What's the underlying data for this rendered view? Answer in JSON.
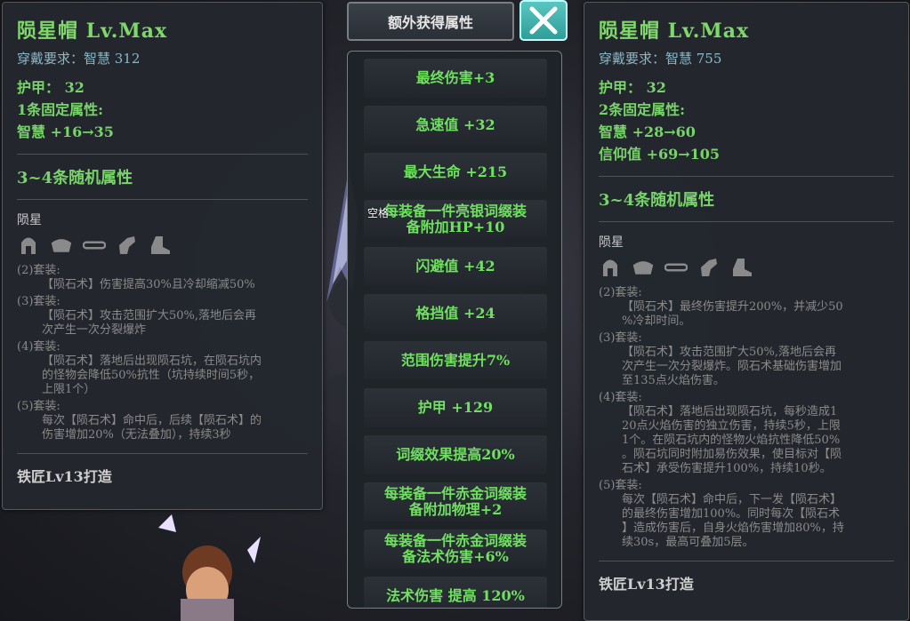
{
  "left_item": {
    "title": "陨星帽 Lv.Max",
    "requirement": "穿戴要求：智慧 312",
    "armor": "护甲：  32",
    "fixed_header": "1条固定属性:",
    "fixed": [
      "智慧 +16→35"
    ],
    "random_header": "3~4条随机属性",
    "set_name": "陨星",
    "set_icons": [
      "helmet-icon",
      "shoulder-armor-icon",
      "belt-icon",
      "glove-icon",
      "boot-icon"
    ],
    "bonuses": [
      {
        "head": "(2)套装:",
        "body": [
          "【陨石术】伤害提高30%且冷却缩减50%"
        ]
      },
      {
        "head": "(3)套装:",
        "body": [
          "【陨石术】攻击范围扩大50%,落地后会再",
          "次产生一次分裂爆炸"
        ]
      },
      {
        "head": "(4)套装:",
        "body": [
          "【陨石术】落地后出现陨石坑，在陨石坑内",
          "的怪物会降低50%抗性（坑持续时间5秒，",
          "上限1个）"
        ]
      },
      {
        "head": "(5)套装:",
        "body": [
          "每次【陨石术】命中后，后续【陨石术】的",
          "伤害增加20%（无法叠加），持续3秒"
        ]
      }
    ],
    "crafter": "铁匠Lv13打造"
  },
  "extra": {
    "tab_label": "额外获得属性",
    "close_icon": "close-icon",
    "space_hint": "空格",
    "attributes": [
      [
        "最终伤害+3"
      ],
      [
        "急速值 +32"
      ],
      [
        "最大生命 +215"
      ],
      [
        "每装备一件亮银词缀装",
        "备附加HP+10"
      ],
      [
        "闪避值 +42"
      ],
      [
        "格挡值 +24"
      ],
      [
        "范围伤害提升7%"
      ],
      [
        "护甲 +129"
      ],
      [
        "词缀效果提高20%"
      ],
      [
        "每装备一件赤金词缀装",
        "备附加物理+2"
      ],
      [
        "每装备一件赤金词缀装",
        "备法术伤害+6%"
      ],
      [
        "法术伤害 提高 120%"
      ]
    ]
  },
  "right_item": {
    "title": "陨星帽 Lv.Max",
    "requirement": "穿戴要求：智慧 755",
    "armor": "护甲：  32",
    "fixed_header": "2条固定属性:",
    "fixed": [
      "智慧 +28→60",
      "信仰值 +69→105"
    ],
    "random_header": "3~4条随机属性",
    "set_name": "陨星",
    "set_icons": [
      "helmet-icon",
      "shoulder-armor-icon",
      "belt-icon",
      "glove-icon",
      "boot-icon"
    ],
    "bonuses": [
      {
        "head": "(2)套装:",
        "body": [
          "【陨石术】最终伤害提升200%，并减少50",
          "%冷却时间。"
        ]
      },
      {
        "head": "(3)套装:",
        "body": [
          "【陨石术】攻击范围扩大50%,落地后会再",
          "次产生一次分裂爆炸。陨石术基础伤害增加",
          "至135点火焰伤害。"
        ]
      },
      {
        "head": "(4)套装:",
        "body": [
          "【陨石术】落地后出现陨石坑，每秒造成1",
          "20点火焰伤害的独立伤害，持续5秒，上限",
          "1个。在陨石坑内的怪物火焰抗性降低50%",
          "。陨石坑同时附加易伤效果，使目标对【陨",
          "石术】承受伤害提升100%，持续10秒。"
        ]
      },
      {
        "head": "(5)套装:",
        "body": [
          "每次【陨石术】命中后，下一发【陨石术】",
          "的最终伤害增加100%。同时每次【陨石术",
          "】造成伤害后，自身火焰伤害增加80%，持",
          "续30s，最高可叠加5层。"
        ]
      }
    ],
    "crafter": "铁匠Lv13打造"
  },
  "colors": {
    "title_green": "#7fd86a",
    "attr_green": "#6fe060",
    "requirement": "#8ab8c8",
    "close_teal": "#3bb3ad"
  }
}
